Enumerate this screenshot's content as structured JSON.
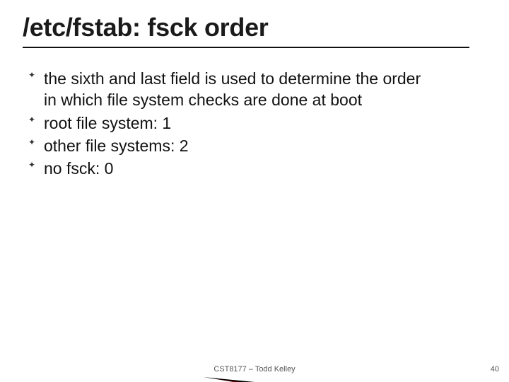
{
  "title": "/etc/fstab: fsck order",
  "bullets": [
    "the sixth and last field is used to determine the order in which file system checks are done at boot",
    "root file system: 1",
    "other file systems: 2",
    "no fsck: 0"
  ],
  "footer": "CST8177 – Todd Kelley",
  "page_number": "40"
}
